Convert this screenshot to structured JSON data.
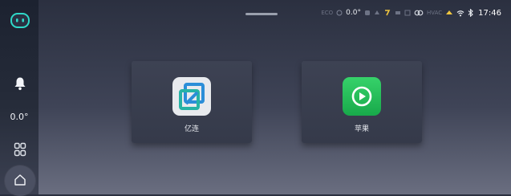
{
  "status_bar": {
    "small_text_1": "ECO",
    "temp": "0.0°",
    "small_text_2": "HVAC",
    "time": "17:46"
  },
  "sidebar": {
    "temperature": "0.0°"
  },
  "apps": [
    {
      "label": "亿连"
    },
    {
      "label": "苹果"
    }
  ],
  "colors": {
    "accent_robot": "#2fd8c8",
    "carplay_green": "#1fbf54",
    "yilian_blue": "#2b8ed8"
  }
}
